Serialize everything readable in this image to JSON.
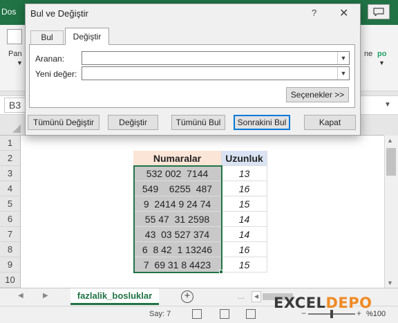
{
  "excel": {
    "file_tab": "Dos",
    "ribbon_left_label": "Pan",
    "ribbon_right_text": "ne",
    "ribbon_right_text_green": "po",
    "name_box": "B3",
    "columns": {
      "num_header": "Numaralar",
      "len_header": "Uzunluk"
    },
    "row_numbers": [
      "1",
      "2",
      "3",
      "4",
      "5",
      "6",
      "7",
      "8",
      "9",
      "10"
    ],
    "rows": [
      {
        "num": "532 002  7144",
        "len": "13"
      },
      {
        "num": "549    6255  487",
        "len": "16"
      },
      {
        "num": "9  2414 9 24 74",
        "len": "15"
      },
      {
        "num": "55 47  31 2598",
        "len": "14"
      },
      {
        "num": "43  03 527 374",
        "len": "14"
      },
      {
        "num": "6  8 42  1 13246",
        "len": "16"
      },
      {
        "num": "7  69 31 8 4423",
        "len": "15"
      }
    ],
    "sheet_tab": "fazlalik_bosluklar",
    "hscroll_dots": "...",
    "status_count": "Say: 7",
    "zoom": "%100"
  },
  "watermark": {
    "part1": "XCEL",
    "part2": "DEPO",
    "prefix": "E"
  },
  "dialog": {
    "title": "Bul ve Değiştir",
    "help": "?",
    "close": "✕",
    "tabs": {
      "find": "Bul",
      "replace": "Değiştir"
    },
    "find_label": "Aranan:",
    "replace_label": "Yeni değer:",
    "find_value": "",
    "replace_value": "",
    "options_button": "Seçenekler >>",
    "buttons": {
      "replace_all": "Tümünü Değiştir",
      "replace": "Değiştir",
      "find_all": "Tümünü Bul",
      "find_next": "Sonrakini Bul",
      "close": "Kapat"
    }
  }
}
